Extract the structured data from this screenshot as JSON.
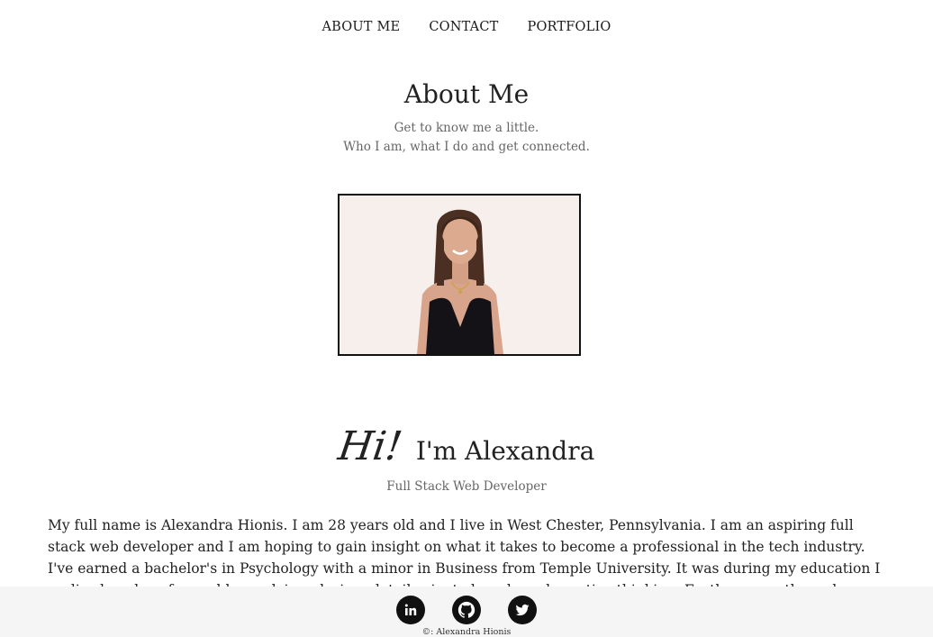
{
  "nav": {
    "about": "ABOUT ME",
    "contact": "CONTACT",
    "portfolio": "PORTFOLIO"
  },
  "header": {
    "title": "About Me",
    "subtitle_line1": "Get to know me a little.",
    "subtitle_line2": "Who I am, what I do and get connected."
  },
  "intro": {
    "hi": "Hi!",
    "name": "I'm Alexandra",
    "role": "Full Stack Web Developer",
    "bio": "My full name is Alexandra Hionis. I am 28 years old and I live in West Chester, Pennsylvania. I am an aspiring full stack web developer and I am hoping to gain insight on what it takes to become a professional in the tech industry. I've earned a bachelor's in Psychology with a minor in Business from Temple University. It was during my education I realized my love for problem-solving, design, detail-oriented work, and creative thinking. Furthermore, through discipline, fervor, hard work and persistence I plan on"
  },
  "footer": {
    "icons": [
      "linkedin-icon",
      "github-icon",
      "twitter-icon"
    ],
    "copyright": "©: Alexandra Hionis"
  }
}
